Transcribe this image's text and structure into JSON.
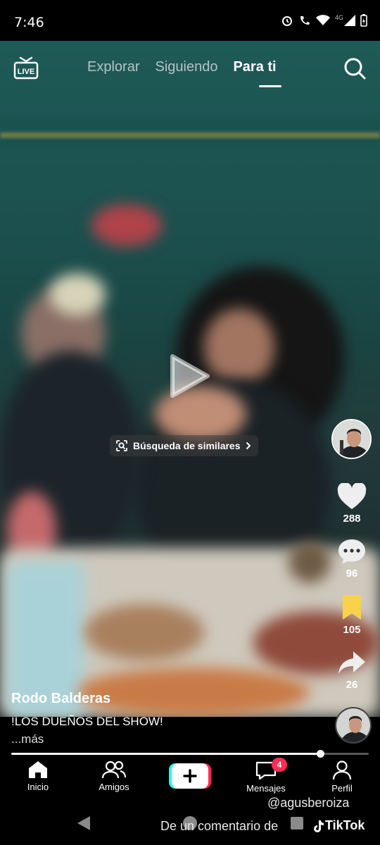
{
  "status_bar": {
    "time": "7:46",
    "network": "4G",
    "icons": [
      "alarm-icon",
      "wifi-call-icon",
      "wifi-icon",
      "signal-icon",
      "battery-icon"
    ]
  },
  "top_nav": {
    "live_label": "LIVE",
    "tabs": [
      {
        "label": "Explorar",
        "active": false
      },
      {
        "label": "Siguiendo",
        "active": false
      },
      {
        "label": "Para ti",
        "active": true
      }
    ]
  },
  "video": {
    "similar_search": "Búsqueda de similares",
    "author": "Rodo Balderas",
    "caption": "!LOS DUEÑOS DEL SHOW!",
    "more": "...más",
    "progress_fraction": 0.865
  },
  "actions": {
    "likes": "288",
    "comments": "96",
    "saves": "105",
    "shares": "26"
  },
  "bottom_nav": {
    "home": "Inicio",
    "friends": "Amigos",
    "messages": "Mensajes",
    "messages_badge": "4",
    "profile": "Perfil"
  },
  "watermark": {
    "user": "@agusberoiza",
    "text": "De un comentario de",
    "brand": "TikTok"
  },
  "colors": {
    "accent_pink": "#fe2c55",
    "accent_cyan": "#25f4ee",
    "bookmark_yellow": "#f8d24a"
  }
}
